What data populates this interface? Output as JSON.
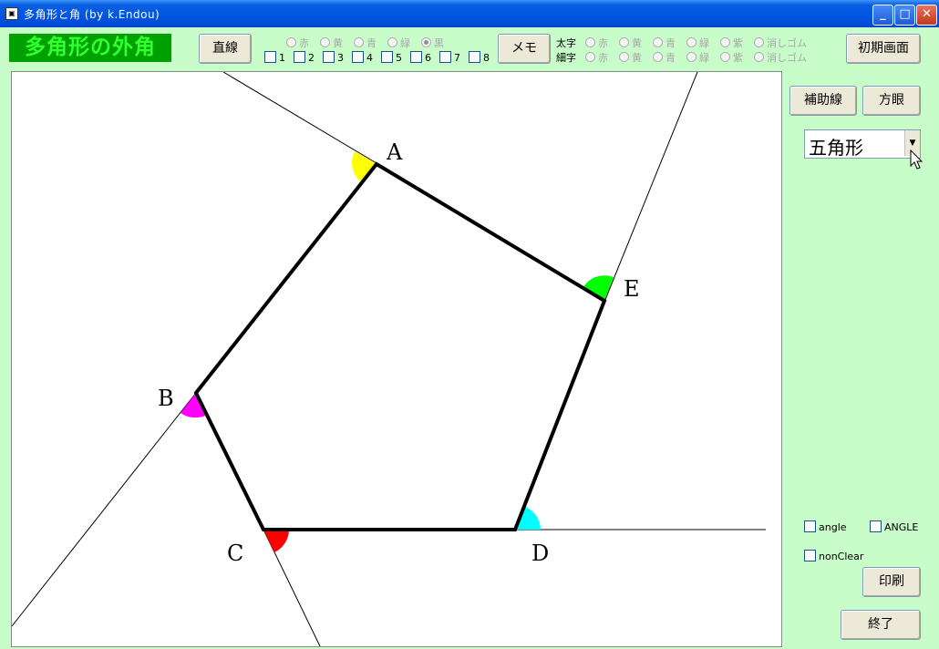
{
  "window": {
    "title": "多角形と角 (by k.Endou)"
  },
  "heading": "多角形の外角",
  "toolbar": {
    "line_button": "直線",
    "memo_button": "メモ",
    "reset_button": "初期画面",
    "line_colors": [
      "赤",
      "黄",
      "青",
      "緑",
      "黒"
    ],
    "line_color_selected": "黒",
    "line_numbers": [
      "1",
      "2",
      "3",
      "4",
      "5",
      "6",
      "7",
      "8"
    ],
    "thick_label": "太字",
    "thin_label": "細字",
    "memo_colors": [
      "赤",
      "黄",
      "青",
      "緑",
      "紫",
      "消しゴム"
    ]
  },
  "side": {
    "aux_button": "補助線",
    "grid_button": "方眼",
    "shape_select": "五角形",
    "angle_label": "angle",
    "ANGLE_label": "ANGLE",
    "nonclear_label": "nonClear",
    "print_button": "印刷",
    "exit_button": "終了"
  },
  "figure": {
    "vertex_labels": [
      "A",
      "B",
      "C",
      "D",
      "E"
    ]
  },
  "colors": {
    "angle_A": "#ffff00",
    "angle_B": "#ff00ff",
    "angle_C": "#ff0000",
    "angle_D": "#00ffff",
    "angle_E": "#00ff00"
  }
}
